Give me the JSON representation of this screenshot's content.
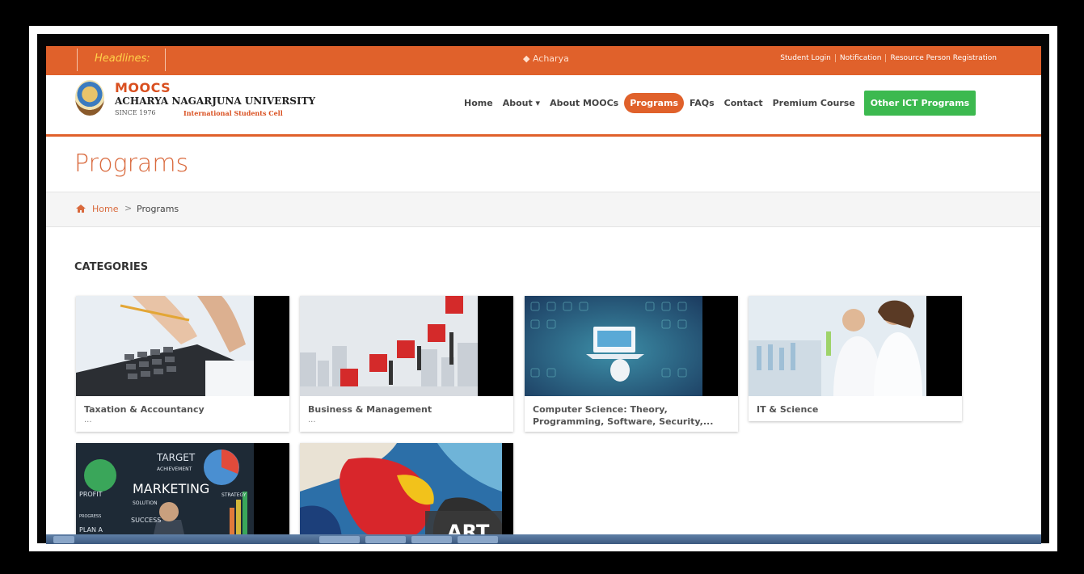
{
  "topbar": {
    "headlines_label": "Headlines:",
    "ticker_text": "◆ Acharya",
    "links": [
      "Student Login",
      "Notification",
      "Resource Person Registration"
    ]
  },
  "brand": {
    "title": "MOOCS",
    "university": "ACHARYA NAGARJUNA UNIVERSITY",
    "since": "SINCE 1976",
    "cell": "International Students Cell"
  },
  "nav": {
    "items": [
      "Home",
      "About ▾",
      "About MOOCs",
      "Programs",
      "FAQs",
      "Contact",
      "Premium Course",
      "Other ICT Programs"
    ]
  },
  "page": {
    "title": "Programs",
    "breadcrumb_home": "Home",
    "breadcrumb_sep": ">",
    "breadcrumb_current": "Programs",
    "categories_heading": "CATEGORIES"
  },
  "cards": [
    {
      "label": "Taxation & Accountancy",
      "more": "..."
    },
    {
      "label": "Business & Management",
      "more": "..."
    },
    {
      "label": "Computer Science: Theory, Programming, Software, Security,...",
      "more": ""
    },
    {
      "label": "IT & Science",
      "more": ""
    },
    {
      "label": "",
      "more": ""
    },
    {
      "label": "",
      "more": ""
    }
  ],
  "card_images": {
    "marketing_words": [
      "TARGET",
      "ACHIEVEMENT",
      "MARKETING",
      "PROFIT",
      "SOLUTION",
      "SUCCESS",
      "PLAN A",
      "PROGRESS",
      "STRATEGY"
    ],
    "art_text": "ART"
  },
  "colors": {
    "brand_orange": "#e0612b",
    "green_button": "#3cb94f"
  }
}
